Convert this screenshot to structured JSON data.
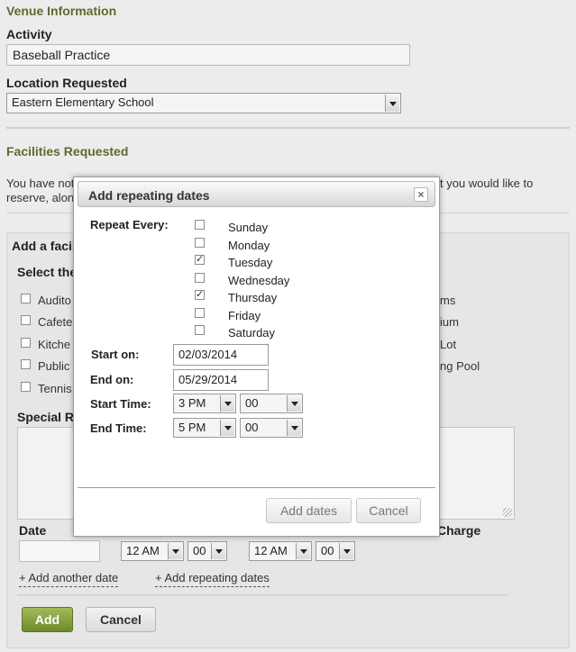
{
  "venue": {
    "section_title": "Venue Information",
    "activity_label": "Activity",
    "activity_value": "Baseball Practice",
    "location_label": "Location Requested",
    "location_value": "Eastern Elementary School"
  },
  "facilities": {
    "section_title": "Facilities Requested",
    "notice_left": "You have not",
    "notice_left2": "reserve, alon",
    "notice_right": "t you would like to",
    "panel_title": "Add a facil",
    "select_label": "Select the",
    "items_left": [
      "Audito",
      "Cafete",
      "Kitche",
      "Public",
      "Tennis"
    ],
    "items_right": [
      "ms",
      "ium",
      "Lot",
      "ng Pool"
    ],
    "special_label": "Special Re"
  },
  "dates": {
    "date_label": "Date",
    "charge_label": "Charge",
    "start_hour": "12 AM",
    "start_min": "00",
    "end_hour": "12 AM",
    "end_min": "00",
    "add_another": "+ Add another date",
    "add_repeating": "+ Add repeating dates"
  },
  "actions": {
    "add_label": "Add",
    "cancel_label": "Cancel"
  },
  "dialog": {
    "title": "Add repeating dates",
    "close_glyph": "×",
    "repeat_label": "Repeat Every:",
    "days": [
      {
        "name": "Sunday",
        "checked": false
      },
      {
        "name": "Monday",
        "checked": false
      },
      {
        "name": "Tuesday",
        "checked": true
      },
      {
        "name": "Wednesday",
        "checked": false
      },
      {
        "name": "Thursday",
        "checked": true
      },
      {
        "name": "Friday",
        "checked": false
      },
      {
        "name": "Saturday",
        "checked": false
      }
    ],
    "start_on_label": "Start on:",
    "start_on_value": "02/03/2014",
    "end_on_label": "End on:",
    "end_on_value": "05/29/2014",
    "start_time_label": "Start Time:",
    "start_time_hour": "3 PM",
    "start_time_min": "00",
    "end_time_label": "End Time:",
    "end_time_hour": "5 PM",
    "end_time_min": "00",
    "add_dates_label": "Add dates",
    "cancel_label": "Cancel"
  },
  "colors": {
    "section_heading": "#5b6b2f",
    "primary_button": "#7f9a36",
    "page_background": "#ececec"
  }
}
